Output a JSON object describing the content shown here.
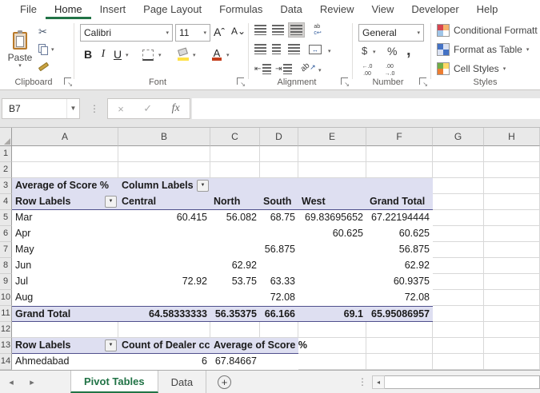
{
  "ribbon": {
    "tabs": [
      "File",
      "Home",
      "Insert",
      "Page Layout",
      "Formulas",
      "Data",
      "Review",
      "View",
      "Developer",
      "Help"
    ],
    "active_tab": "Home",
    "groups": {
      "clipboard": {
        "label": "Clipboard",
        "paste_label": "Paste"
      },
      "font": {
        "label": "Font",
        "font_name": "Calibri",
        "font_size": "11",
        "bold_label": "B",
        "italic_label": "I",
        "underline_label": "U"
      },
      "alignment": {
        "label": "Alignment",
        "wrap_line1": "ab",
        "wrap_line2": "c",
        "orientation_chars": "ab"
      },
      "number": {
        "label": "Number",
        "format": "General",
        "currency_label": "$",
        "percent_label": "%",
        "comma_label": ",",
        "inc_decimal": "←.0\n.00",
        "dec_decimal": ".00\n→.0"
      },
      "styles": {
        "label": "Styles",
        "conditional_label": "Conditional Formatt",
        "format_table_label": "Format as Table",
        "cell_styles_label": "Cell Styles"
      }
    }
  },
  "formula_bar": {
    "name_box": "B7",
    "cancel_glyph": "×",
    "enter_glyph": "✓",
    "fx_label": "fx",
    "value": ""
  },
  "grid": {
    "column_letters": [
      "A",
      "B",
      "C",
      "D",
      "E",
      "F",
      "G",
      "H"
    ],
    "row_count": 14
  },
  "pivot1": {
    "title": "Average of Score %",
    "column_labels_caption": "Column Labels",
    "row_labels_caption": "Row Labels",
    "columns": [
      "Central",
      "North",
      "South",
      "West",
      "Grand Total"
    ],
    "rows": [
      {
        "label": "Mar",
        "values": [
          "60.415",
          "56.082",
          "68.75",
          "69.83695652",
          "67.22194444"
        ]
      },
      {
        "label": "Apr",
        "values": [
          "",
          "",
          "",
          "60.625",
          "60.625"
        ]
      },
      {
        "label": "May",
        "values": [
          "",
          "",
          "56.875",
          "",
          "56.875"
        ]
      },
      {
        "label": "Jun",
        "values": [
          "",
          "62.92",
          "",
          "",
          "62.92"
        ]
      },
      {
        "label": "Jul",
        "values": [
          "72.92",
          "53.75",
          "63.33",
          "",
          "60.9375"
        ]
      },
      {
        "label": "Aug",
        "values": [
          "",
          "",
          "72.08",
          "",
          "72.08"
        ]
      }
    ],
    "grand_total": {
      "label": "Grand Total",
      "values": [
        "64.58333333",
        "56.35375",
        "66.166",
        "69.1",
        "65.95086957"
      ]
    }
  },
  "pivot2": {
    "row_labels_caption": "Row Labels",
    "columns": [
      "Count of Dealer cc",
      "Average of Score %"
    ],
    "rows": [
      {
        "label": "Ahmedabad",
        "values": [
          "6",
          "67.84667"
        ]
      }
    ]
  },
  "sheet_bar": {
    "tabs": [
      "Pivot Tables",
      "Data"
    ],
    "active_tab": "Pivot Tables"
  },
  "colors": {
    "accent_green": "#217346",
    "pivot_fill": "#DEDFF1",
    "pivot_border": "#4F4F8C",
    "fill_yellow": "#FFE145",
    "font_red": "#C43E1C"
  }
}
